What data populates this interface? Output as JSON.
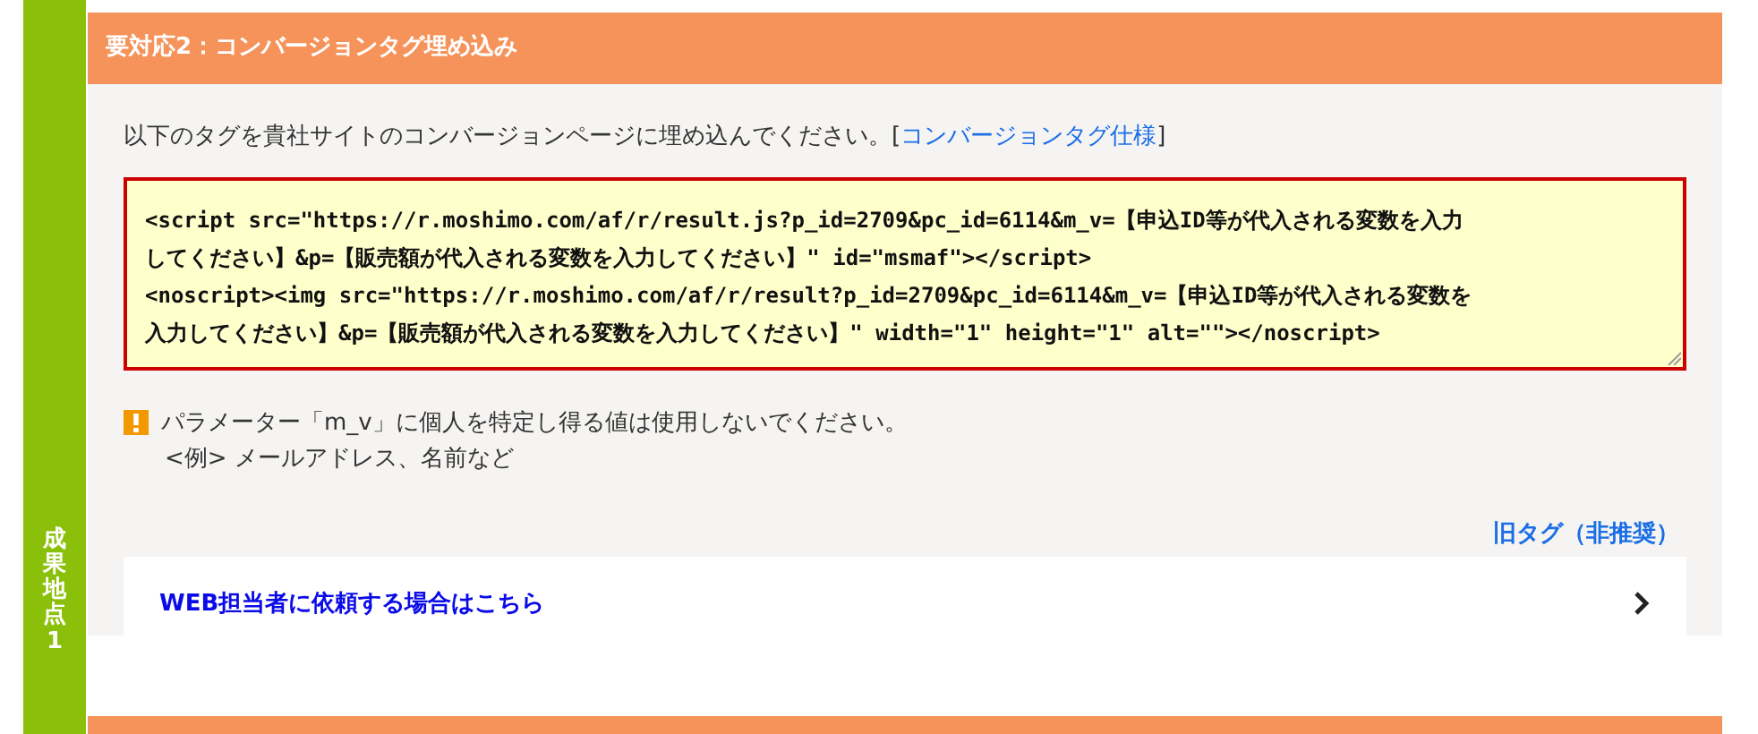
{
  "side_label": "成果地点1",
  "header": {
    "title": "要対応2：コンバージョンタグ埋め込み"
  },
  "intro": {
    "text": "以下のタグを貴社サイトのコンバージョンページに埋め込んでください。[",
    "link": "コンバージョンタグ仕様",
    "text_end": "]"
  },
  "code_field": {
    "lines": [
      "<script src=\"https://r.moshimo.com/af/r/result.js?p_id=2709&pc_id=6114&m_v=【申込ID等が代入される変数を入力",
      "してください】&p=【販売額が代入される変数を入力してください】\" id=\"msmaf\"></script>",
      "<noscript><img src=\"https://r.moshimo.com/af/r/result?p_id=2709&pc_id=6114&m_v=【申込ID等が代入される変数を",
      "入力してください】&p=【販売額が代入される変数を入力してください】\" width=\"1\" height=\"1\" alt=\"\"></noscript>"
    ]
  },
  "notice": {
    "lines": [
      "パラメーター「m_v」に個人を特定し得る値は使用しないでください。",
      "<例> メールアドレス、名前など"
    ]
  },
  "old_tag_link": "旧タグ（非推奨）",
  "request_card": {
    "label": "WEB担当者に依頼する場合はこちら"
  }
}
